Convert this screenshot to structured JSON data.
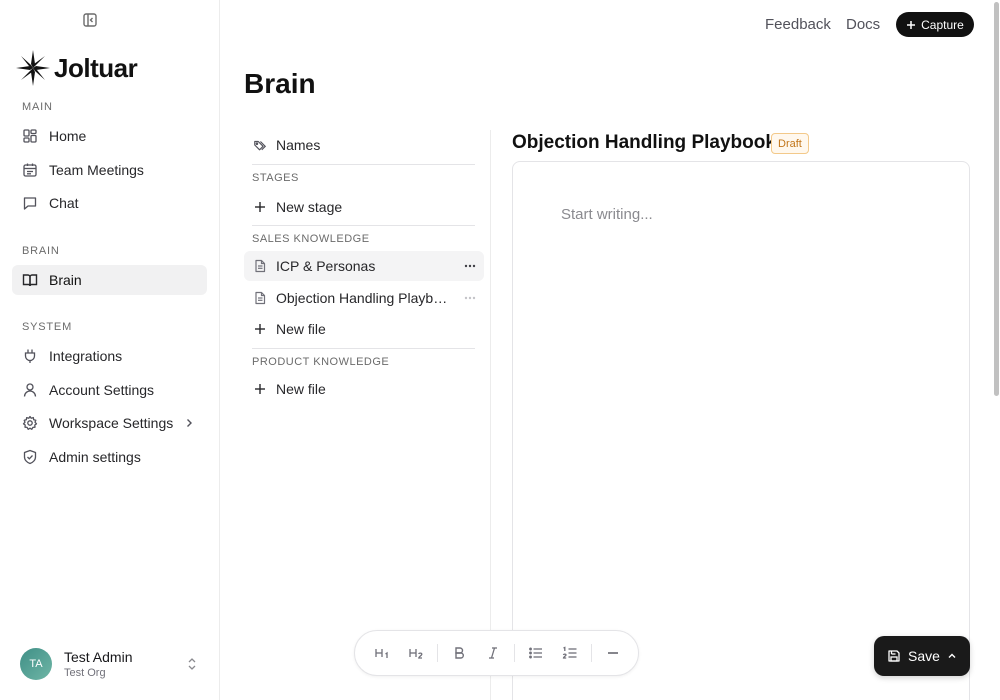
{
  "app": {
    "name": "Joltuar"
  },
  "topbar": {
    "feedback": "Feedback",
    "docs": "Docs",
    "capture": "Capture"
  },
  "sidebar": {
    "sections": {
      "main": "MAIN",
      "brain": "BRAIN",
      "system": "SYSTEM"
    },
    "items": {
      "home": "Home",
      "team_meetings": "Team Meetings",
      "chat": "Chat",
      "brain": "Brain",
      "integrations": "Integrations",
      "account_settings": "Account Settings",
      "workspace_settings": "Workspace Settings",
      "admin_settings": "Admin settings"
    },
    "user": {
      "initials": "TA",
      "name": "Test Admin",
      "org": "Test Org"
    }
  },
  "page": {
    "title": "Brain"
  },
  "tree": {
    "names": "Names",
    "stages_label": "STAGES",
    "new_stage": "New stage",
    "sales_label": "SALES KNOWLEDGE",
    "sales_files": [
      "ICP & Personas",
      "Objection Handling Playbook"
    ],
    "new_file": "New file",
    "product_label": "PRODUCT KNOWLEDGE",
    "new_file_product": "New file"
  },
  "document": {
    "title": "Objection Handling Playbook",
    "status": "Draft",
    "placeholder": "Start writing..."
  },
  "toolbar": {
    "h1": "H1",
    "h2": "H2",
    "bold": "B",
    "italic": "I"
  },
  "actions": {
    "save": "Save"
  }
}
